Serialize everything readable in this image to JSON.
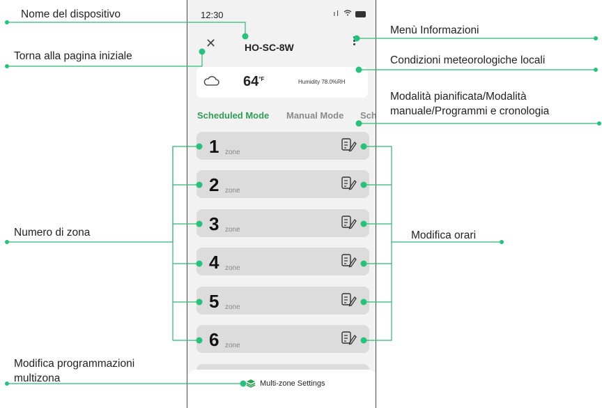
{
  "status_bar": {
    "time": "12:30",
    "signal_icon": "signal-icon",
    "wifi_icon": "wifi-icon",
    "battery_icon": "battery-icon"
  },
  "header": {
    "device_name": "HO-SC-8W",
    "close_icon": "close-icon",
    "menu_icon": "kebab-menu-icon"
  },
  "weather": {
    "icon": "cloud-icon",
    "temperature": "64",
    "unit": "°F",
    "humidity": "Humidity 78.0%RH"
  },
  "tabs": [
    {
      "label": "Scheduled Mode",
      "active": true
    },
    {
      "label": "Manual Mode",
      "active": false
    },
    {
      "label": "Sch",
      "active": false
    }
  ],
  "zones": [
    {
      "number": "1",
      "label": "zone"
    },
    {
      "number": "2",
      "label": "zone"
    },
    {
      "number": "3",
      "label": "zone"
    },
    {
      "number": "4",
      "label": "zone"
    },
    {
      "number": "5",
      "label": "zone"
    },
    {
      "number": "6",
      "label": "zone"
    }
  ],
  "bottom_sheet": {
    "label": "Multi-zone Settings",
    "icon": "layers-icon"
  },
  "annotations": {
    "device_name": "Nome del dispositivo",
    "home": "Torna alla pagina iniziale",
    "menu": "Menù Informazioni",
    "weather": "Condizioni meteorologiche locali",
    "modes_line1": "Modalità pianificata/Modalità",
    "modes_line2": "manuale/Programmi e cronologia",
    "zone_number": "Numero di zona",
    "edit_schedule": "Modifica orari",
    "multizone_line1": "Modifica programmazioni",
    "multizone_line2": "multizona"
  },
  "colors": {
    "accent": "#2e9e55",
    "annotation_dot": "#27c27a",
    "line": "#2db874"
  }
}
